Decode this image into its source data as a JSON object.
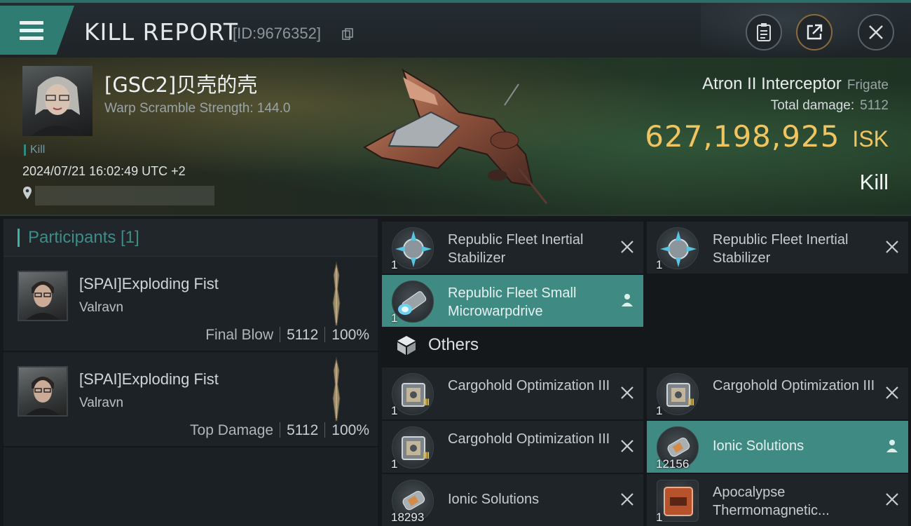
{
  "header": {
    "title": "KILL REPORT",
    "kill_id": "[ID:9676352]",
    "icons": [
      "menu-icon",
      "copy-icon",
      "clipboard-icon",
      "share-icon",
      "close-icon"
    ]
  },
  "victim": {
    "name": "[GSC2]贝壳的壳",
    "warp_scramble": "Warp Scramble Strength: 144.0",
    "tag": "Kill",
    "datetime": "2024/07/21 16:02:49 UTC +2",
    "ship_name": "Atron II Interceptor",
    "ship_class": "Frigate",
    "total_damage_label": "Total damage:",
    "total_damage": "5112",
    "isk_value": "627,198,925",
    "isk_unit": "ISK",
    "result": "Kill"
  },
  "participants": {
    "heading": "Participants [1]",
    "rows": [
      {
        "name": "[SPAI]Exploding Fist",
        "corp": "Valravn",
        "label": "Final Blow",
        "damage": "5112",
        "percent": "100%"
      },
      {
        "name": "[SPAI]Exploding Fist",
        "corp": "Valravn",
        "label": "Top Damage",
        "damage": "5112",
        "percent": "100%"
      }
    ]
  },
  "items": {
    "others_heading": "Others",
    "list": [
      {
        "name": "Republic Fleet Inertial Stabilizer",
        "qty": "1",
        "state": "destroyed",
        "icon": "inertial-stabilizer-icon"
      },
      {
        "name": "Republic Fleet Inertial Stabilizer",
        "qty": "1",
        "state": "destroyed",
        "icon": "inertial-stabilizer-icon"
      },
      {
        "name": "Republic Fleet Small Microwarpdrive",
        "qty": "1",
        "state": "dropped",
        "icon": "microwarpdrive-icon"
      },
      {
        "name": "Cargohold Optimization III",
        "qty": "1",
        "state": "destroyed",
        "icon": "rig-icon",
        "meta": "III"
      },
      {
        "name": "Cargohold Optimization III",
        "qty": "1",
        "state": "destroyed",
        "icon": "rig-icon",
        "meta": "III"
      },
      {
        "name": "Cargohold Optimization III",
        "qty": "1",
        "state": "destroyed",
        "icon": "rig-icon",
        "meta": "III"
      },
      {
        "name": "Ionic Solutions",
        "qty": "12156",
        "state": "dropped",
        "icon": "canister-icon"
      },
      {
        "name": "Ionic Solutions",
        "qty": "18293",
        "state": "destroyed",
        "icon": "canister-icon"
      },
      {
        "name": "Apocalypse Thermomagnetic...",
        "qty": "1",
        "state": "destroyed",
        "icon": "blueprint-icon"
      }
    ]
  },
  "colors": {
    "accent": "#3f8b83",
    "isk": "#f0c460",
    "participants_heading": "#3e8d88"
  }
}
